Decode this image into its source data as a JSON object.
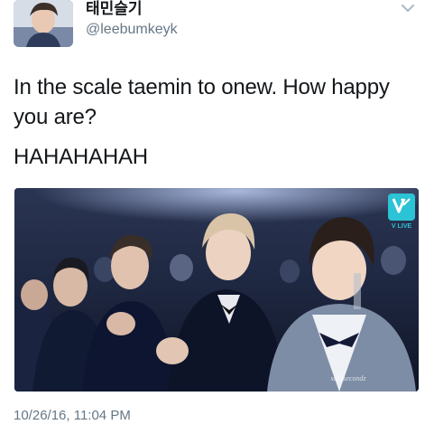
{
  "tweet": {
    "display_name": "태민슬기",
    "handle": "@leebumkeyk",
    "text_line1": "In the scale taemin to onew. How happy you are?",
    "text_line2": "HAHAHAHAH",
    "timestamp": "10/26/16, 11:04 PM",
    "avatar_icon": "profile-photo",
    "menu_icon": "chevron-down-icon"
  },
  "media": {
    "badge_icon": "vlive-logo",
    "badge_text": "V LIVE",
    "watermark": "sallisecondz"
  },
  "colors": {
    "text_primary": "#14171a",
    "text_secondary": "#657786",
    "background": "#ffffff",
    "vlive_badge": "#2bc3d6"
  }
}
